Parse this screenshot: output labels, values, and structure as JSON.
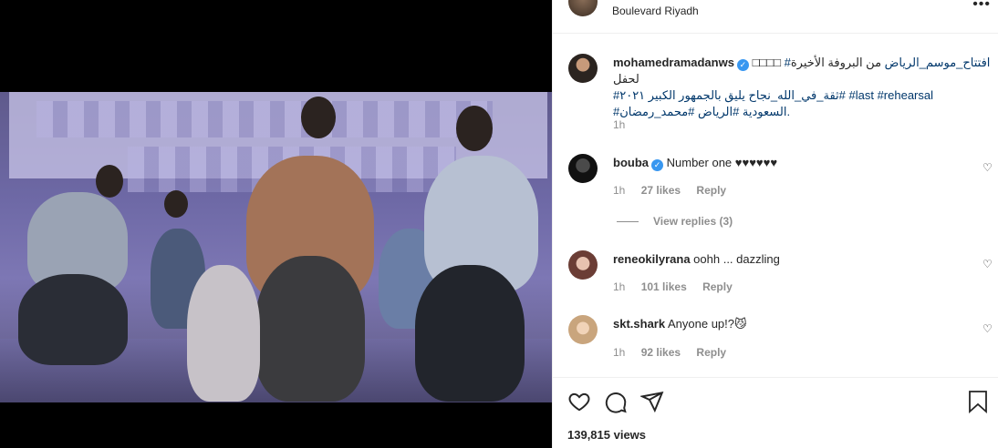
{
  "header": {
    "location": "Boulevard Riyadh",
    "more": "•••"
  },
  "post": {
    "username": "mohamedramadanws",
    "caption_line1_prefix": "من البروفة الأخيرة لحفل ",
    "caption_line1_tag": "#افتتاح_موسم_الرياض",
    "caption_line1_boxes": " □□□□",
    "caption_line2_tag1": "#ثقة_في_الله_نجاح يليق بالجمهور الكبير",
    "caption_line2_mid": " ٢٠٢١# ",
    "caption_line2_tag2": "#last",
    "caption_line2_tag3": " #rehearsal",
    "caption_line3": "#السعودية #الرياض #محمد_رمضان.",
    "time": "1h"
  },
  "comments": [
    {
      "username": "bouba",
      "verified": true,
      "text": "Number one ♥♥♥♥♥♥",
      "time": "1h",
      "likes": "27 likes",
      "reply": "Reply"
    },
    {
      "username": "reneokilyrana",
      "verified": false,
      "text": "oohh ... dazzling",
      "time": "1h",
      "likes": "101 likes",
      "reply": "Reply"
    },
    {
      "username": "skt.shark",
      "verified": false,
      "text": "Anyone up!?😼",
      "time": "1h",
      "likes": "92 likes",
      "reply": "Reply"
    }
  ],
  "view_replies": "View replies (3)",
  "views": "139,815 views",
  "icons": {
    "like": "heart-icon",
    "comment": "comment-icon",
    "share": "share-icon",
    "save": "bookmark-icon"
  }
}
